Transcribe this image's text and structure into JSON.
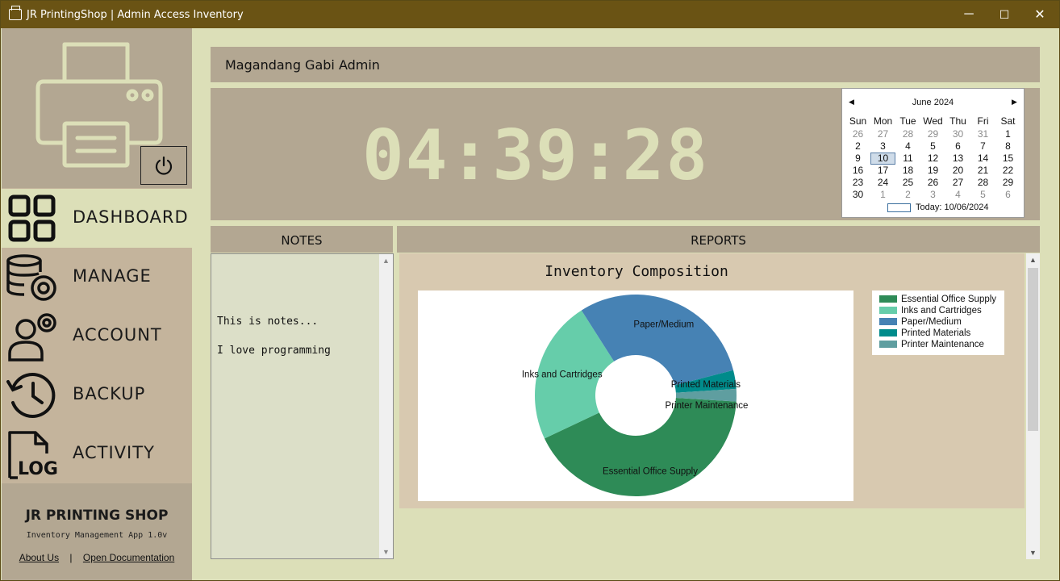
{
  "window": {
    "title": "JR PrintingShop | Admin Access Inventory",
    "controls": {
      "minimize": "─",
      "maximize": "☐",
      "close": "✕"
    }
  },
  "sidebar": {
    "items": [
      {
        "label": "DASHBOARD",
        "icon": "dashboard-grid-icon",
        "active": true
      },
      {
        "label": "MANAGE",
        "icon": "database-gear-icon",
        "active": false
      },
      {
        "label": "ACCOUNT",
        "icon": "user-gear-icon",
        "active": false
      },
      {
        "label": "BACKUP",
        "icon": "history-clock-icon",
        "active": false
      },
      {
        "label": "ACTIVITY",
        "icon": "log-file-icon",
        "active": false
      }
    ],
    "footer": {
      "shop_name": "JR PRINTING SHOP",
      "version": "Inventory Management App 1.0v",
      "about": "About Us",
      "separator": "|",
      "docs": "Open Documentation"
    }
  },
  "header": {
    "admin_name": "Magandang Gabi Admin"
  },
  "clock": {
    "time": "04:39:28"
  },
  "calendar": {
    "month": "June 2024",
    "days_of_week": [
      "Sun",
      "Mon",
      "Tue",
      "Wed",
      "Thu",
      "Fri",
      "Sat"
    ],
    "weeks": [
      [
        "26",
        "27",
        "28",
        "29",
        "30",
        "31",
        "1"
      ],
      [
        "2",
        "3",
        "4",
        "5",
        "6",
        "7",
        "8"
      ],
      [
        "9",
        "10",
        "11",
        "12",
        "13",
        "14",
        "15"
      ],
      [
        "16",
        "17",
        "18",
        "19",
        "20",
        "21",
        "22"
      ],
      [
        "23",
        "24",
        "25",
        "26",
        "27",
        "28",
        "29"
      ],
      [
        "30",
        "1",
        "2",
        "3",
        "4",
        "5",
        "6"
      ]
    ],
    "selected": "10",
    "today_label": "Today: 10/06/2024"
  },
  "notes": {
    "header": "NOTES",
    "text": "This is notes...\n\nI love programming"
  },
  "reports": {
    "header": "REPORTS"
  },
  "chart_data": {
    "type": "pie",
    "title": "Inventory Composition",
    "categories": [
      "Essential Office Supply",
      "Inks and Cartridges",
      "Paper/Medium",
      "Printed Materials",
      "Printer Maintenance"
    ],
    "values": [
      42,
      23,
      30,
      3,
      2
    ],
    "colors": [
      "#2e8b57",
      "#66cdaa",
      "#4682b4",
      "#008b8b",
      "#5f9ea0"
    ],
    "legend": "right",
    "donut": true
  }
}
